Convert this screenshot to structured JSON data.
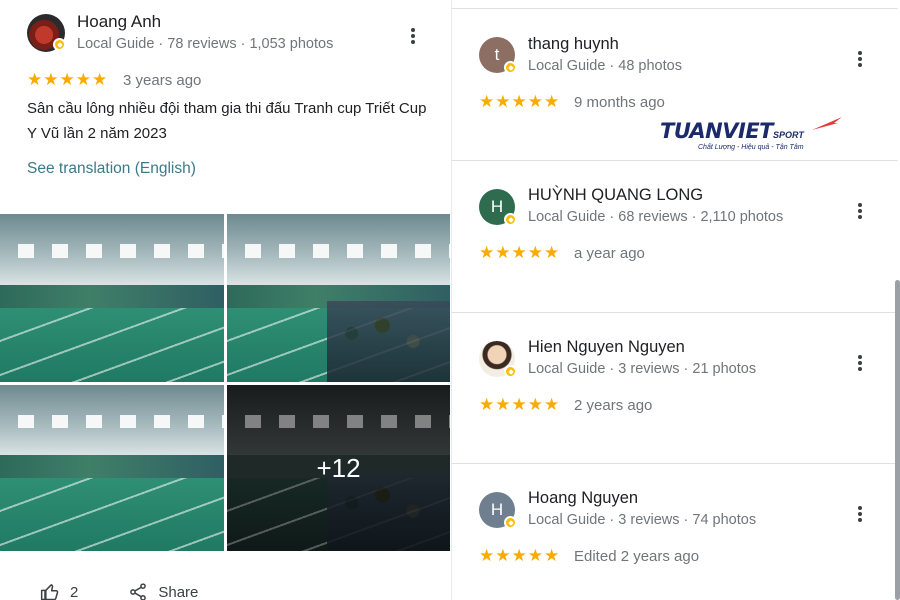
{
  "left_review": {
    "name": "Hoang Anh",
    "meta": "Local Guide · 78 reviews · 1,053 photos",
    "stars": "★★★★★",
    "date": "3 years ago",
    "text": "Sân cầu lông nhiều đội tham gia thi đấu Tranh cup Triết Cup Y Vũ lần 2 năm 2023",
    "translate_link": "See translation (English)",
    "more_photos": "+12",
    "like_count": "2",
    "share_label": "Share"
  },
  "reviews": [
    {
      "initial": "t",
      "avatar_color": "#8d6e63",
      "name": "thang huynh",
      "meta": "Local Guide · 48 photos",
      "stars": "★★★★★",
      "date": "9 months ago"
    },
    {
      "initial": "H",
      "avatar_color": "#2e6b4f",
      "name": "HUỲNH QUANG LONG",
      "meta": "Local Guide · 68 reviews · 2,110 photos",
      "stars": "★★★★★",
      "date": "a year ago"
    },
    {
      "initial": "",
      "avatar_color": "#e8dcc8",
      "name": "Hien Nguyen Nguyen",
      "meta": "Local Guide · 3 reviews · 21 photos",
      "stars": "★★★★★",
      "date": "2 years ago"
    },
    {
      "initial": "H",
      "avatar_color": "#6f7f8f",
      "name": "Hoang Nguyen",
      "meta": "Local Guide · 3 reviews · 74 photos",
      "stars": "★★★★★",
      "date": "Edited 2 years ago"
    }
  ],
  "logo": {
    "word": "TUANVIET",
    "sport": "SPORT",
    "tagline": "Chất Lượng - Hiệu quả - Tận Tâm"
  },
  "colors": {
    "star": "#f9ab00",
    "link": "#3b7a8a",
    "meta": "#70757a"
  }
}
